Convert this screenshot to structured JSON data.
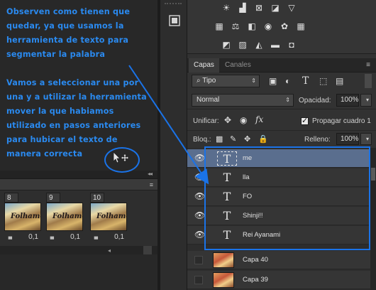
{
  "annotation": {
    "line1": "Observen como tienen que quedar, ya que usamos la herramienta de texto para segmentar la palabra",
    "line2": "Vamos a seleccionar una por una y a utilizar la herramienta mover la que habiamos utilizado en pasos anteriores para hubicar el texto de manera correcta"
  },
  "timeline": {
    "frames": [
      {
        "number": "8",
        "delay": "0,1",
        "thumb_text": "Folhame"
      },
      {
        "number": "9",
        "delay": "0,1",
        "thumb_text": "Folhame"
      },
      {
        "number": "10",
        "delay": "0,1",
        "thumb_text": "Folhame"
      }
    ]
  },
  "panel": {
    "tabs": [
      "Capas",
      "Canales"
    ],
    "filter_label": "Tipo",
    "blend_mode": "Normal",
    "opacity_label": "Opacidad:",
    "opacity_value": "100%",
    "unify_label": "Unificar:",
    "propagate_label": "Propagar cuadro 1",
    "propagate_checked": true,
    "lock_label": "Bloq.:",
    "fill_label": "Relleno:",
    "fill_value": "100%"
  },
  "layers": [
    {
      "name": "me",
      "kind": "text",
      "visible": true,
      "selected": true
    },
    {
      "name": "lla",
      "kind": "text",
      "visible": true,
      "selected": false
    },
    {
      "name": "FO",
      "kind": "text",
      "visible": true,
      "selected": false
    },
    {
      "name": "Shinji!!",
      "kind": "text",
      "visible": true,
      "selected": false
    },
    {
      "name": "Rei Ayanami",
      "kind": "text",
      "visible": true,
      "selected": false
    },
    {
      "name": "Capa 40",
      "kind": "image",
      "visible": false,
      "selected": false
    },
    {
      "name": "Capa 39",
      "kind": "image",
      "visible": false,
      "selected": false
    }
  ],
  "colors": {
    "annotation_blue": "#1a73e8",
    "selected_row": "#5a6e8e"
  }
}
